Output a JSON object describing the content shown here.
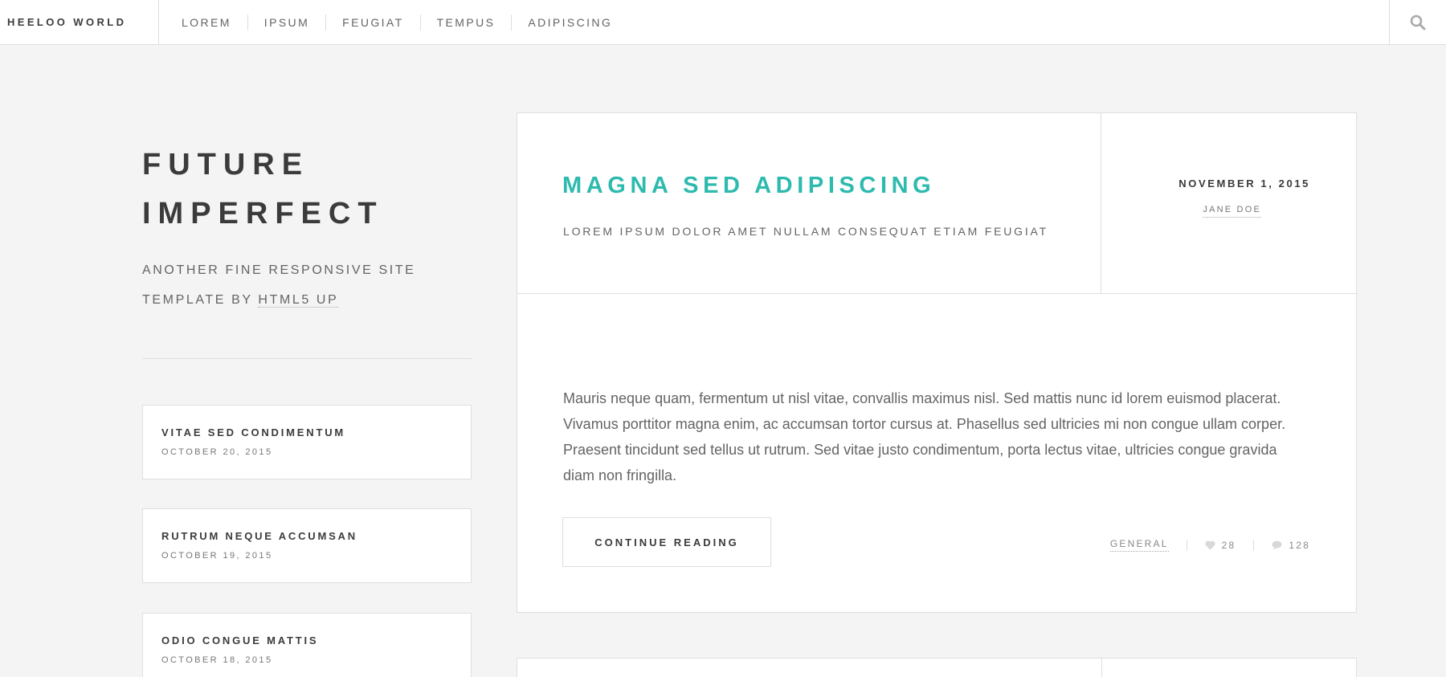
{
  "header": {
    "brand": "HEELOO WORLD",
    "nav": [
      "LOREM",
      "IPSUM",
      "FEUGIAT",
      "TEMPUS",
      "ADIPISCING"
    ],
    "search_icon": "search-icon"
  },
  "intro": {
    "title_line1": "FUTURE",
    "title_line2": "IMPERFECT",
    "subtitle_prefix": "ANOTHER FINE RESPONSIVE SITE TEMPLATE BY ",
    "subtitle_link": "HTML5 UP"
  },
  "mini_posts": [
    {
      "title": "VITAE SED CONDIMENTUM",
      "date": "OCTOBER 20, 2015"
    },
    {
      "title": "RUTRUM NEQUE ACCUMSAN",
      "date": "OCTOBER 19, 2015"
    },
    {
      "title": "ODIO CONGUE MATTIS",
      "date": "OCTOBER 18, 2015"
    }
  ],
  "post": {
    "title": "MAGNA SED ADIPISCING",
    "subtitle": "LOREM IPSUM DOLOR AMET NULLAM CONSEQUAT ETIAM FEUGIAT",
    "date": "NOVEMBER 1, 2015",
    "author": "JANE DOE",
    "body": "Mauris neque quam, fermentum ut nisl vitae, convallis maximus nisl. Sed mattis nunc id lorem euismod placerat. Vivamus porttitor magna enim, ac accumsan tortor cursus at. Phasellus sed ultricies mi non congue ullam corper. Praesent tincidunt sed tellus ut rutrum. Sed vitae justo condimentum, porta lectus vitae, ultricies congue gravida diam non fringilla.",
    "continue_label": "CONTINUE READING",
    "category": "GENERAL",
    "likes": "28",
    "comments": "128"
  },
  "colors": {
    "accent": "#2ebaae",
    "background": "#f4f4f4",
    "text_dark": "#3c3b3b",
    "text_muted": "#646464",
    "border": "#dedede"
  }
}
